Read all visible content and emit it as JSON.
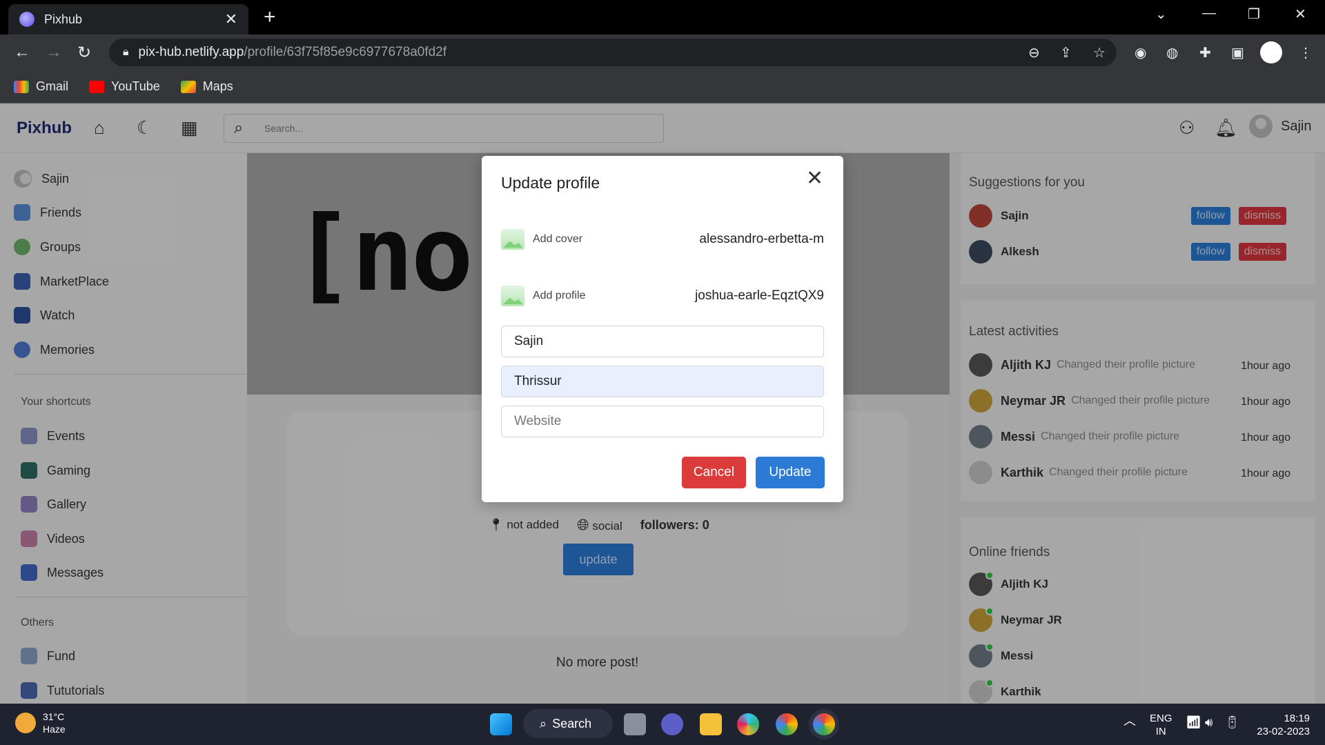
{
  "browser": {
    "tab_title": "Pixhub",
    "url_host": "pix-hub.netlify.app",
    "url_path": "/profile/63f75f85e9c6977678a0fd2f",
    "bookmarks": [
      "Gmail",
      "YouTube",
      "Maps"
    ]
  },
  "app": {
    "logo": "Pixhub",
    "search_placeholder": "Search...",
    "user_name": "Sajin"
  },
  "left_sidebar": {
    "items": [
      "Sajin",
      "Friends",
      "Groups",
      "MarketPlace",
      "Watch",
      "Memories"
    ],
    "shortcuts_title": "Your shortcuts",
    "shortcuts": [
      "Events",
      "Gaming",
      "Gallery",
      "Videos",
      "Messages"
    ],
    "others_title": "Others",
    "others": [
      "Fund",
      "Tututorials"
    ]
  },
  "profile": {
    "cover_text": "[no          ]",
    "location": "not added",
    "website": "social",
    "followers": "followers: 0",
    "update_label": "update",
    "no_more_posts": "No more post!"
  },
  "modal": {
    "title": "Update profile",
    "add_cover_label": "Add cover",
    "cover_file": "alessandro-erbetta-m",
    "add_profile_label": "Add profile",
    "profile_file": "joshua-earle-EqztQX9",
    "name_value": "Sajin",
    "city_value": "Thrissur",
    "website_placeholder": "Website",
    "cancel_label": "Cancel",
    "update_label": "Update"
  },
  "suggestions": {
    "title": "Suggestions for you",
    "users": [
      "Sajin",
      "Alkesh"
    ],
    "follow_label": "follow",
    "dismiss_label": "dismiss"
  },
  "activities": {
    "title": "Latest activities",
    "items": [
      {
        "name": "Aljith KJ",
        "desc": "Changed their profile picture",
        "time": "1hour ago"
      },
      {
        "name": "Neymar JR",
        "desc": "Changed their profile picture",
        "time": "1hour ago"
      },
      {
        "name": "Messi",
        "desc": "Changed their profile picture",
        "time": "1hour ago"
      },
      {
        "name": "Karthik",
        "desc": "Changed their profile picture",
        "time": "1hour ago"
      }
    ]
  },
  "online": {
    "title": "Online friends",
    "friends": [
      "Aljith KJ",
      "Neymar JR",
      "Messi",
      "Karthik"
    ]
  },
  "taskbar": {
    "temp": "31°C",
    "weather": "Haze",
    "search_label": "Search",
    "lang_top": "ENG",
    "lang_bottom": "IN",
    "time": "18:19",
    "date": "23-02-2023"
  }
}
